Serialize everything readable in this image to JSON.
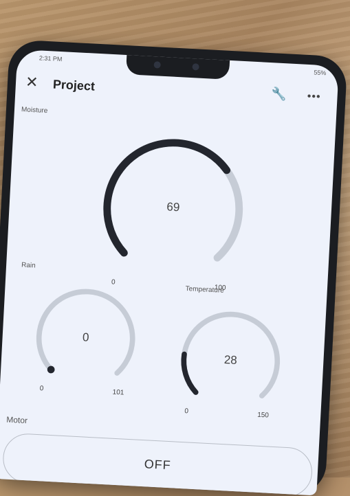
{
  "status_bar": {
    "time": "2:31 PM",
    "battery": "55%"
  },
  "app_bar": {
    "title": "Project",
    "close_icon": "close-icon",
    "wrench_icon": "wrench-icon",
    "more_icon": "more-icon"
  },
  "gauges": [
    {
      "label": "Moisture",
      "value": "69",
      "min": "0",
      "max": "100",
      "fill_fraction": 0.69
    },
    {
      "label": "Rain",
      "value": "0",
      "min": "0",
      "max": "101",
      "fill_fraction": 0.0
    },
    {
      "label": "Temperature",
      "value": "28",
      "min": "0",
      "max": "150",
      "fill_fraction": 0.187
    }
  ],
  "motor": {
    "label": "Motor",
    "button_text": "OFF"
  },
  "colors": {
    "gauge_track": "#c6ccd6",
    "gauge_fill": "#23262e",
    "screen_bg": "#eef2fb"
  }
}
